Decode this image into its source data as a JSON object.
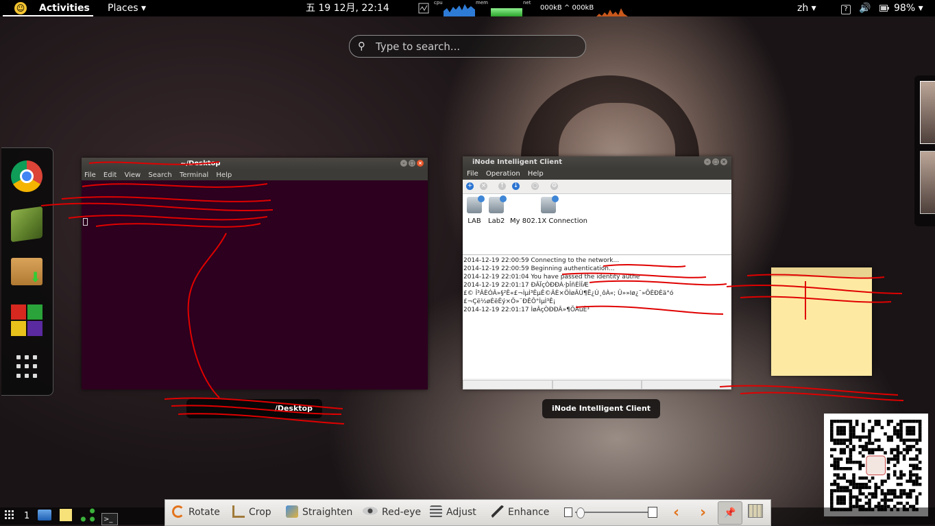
{
  "topbar": {
    "activities": "Activities",
    "places": "Places ▾",
    "clock": "五 19 12月, 22:14",
    "cpu_label": "cpu",
    "mem_label": "mem",
    "net_label": "net",
    "net_speed": "000kB ^ 000kB",
    "lang": "zh ▾",
    "help_icon": "?",
    "battery": "98% ▾"
  },
  "search": {
    "placeholder": "Type to search..."
  },
  "dash": {
    "apps": [
      "chrome-icon",
      "book-icon",
      "package-installer-icon",
      "office-blocks-icon",
      "show-apps-icon"
    ]
  },
  "terminal": {
    "title": "~/Desktop",
    "menu": [
      "File",
      "Edit",
      "View",
      "Search",
      "Terminal",
      "Help"
    ],
    "caption": "/Desktop"
  },
  "inode": {
    "title": "iNode Intelligent Client",
    "menu": [
      "File",
      "Operation",
      "Help"
    ],
    "connections": [
      "LAB",
      "Lab2",
      "My 802.1X Connection"
    ],
    "log": [
      "2014-12-19 22:00:59 Connecting to the network...",
      "2014-12-19 22:00:59 Beginning authentication...",
      "2014-12-19 22:01:04 You have passed the identity authe",
      "2014-12-19 22:01:17 ĐÂÏçÒĐÐÁ·þÎñÈÌÎÆ",
      "£© Î³ÂÈÓÂ»§²Ê«£¬ÌµÌ³ÊµÊ©ÂÈ×ÖÌøÂÙ¶Ë¿Ú¸ôÀ«; Ü»»Iø¿¨»ÕÈÐÈä°ó",
      "£¬Çë½øÈëÊý×Ö»¨ÐÊÔ°ÌµÌ³Ê¡",
      "2014-12-19 22:01:17 ÌøÂçÒÐÐÂ»¶ÕÀúÈ³"
    ],
    "caption": "iNode Intelligent Client"
  },
  "bottom": {
    "workspace": "1",
    "tools": [
      "Rotate",
      "Crop",
      "Straighten",
      "Red-eye",
      "Adjust",
      "Enhance"
    ]
  },
  "colors": {
    "terminal_bg": "#2c001e",
    "note_bg": "#fde9a2",
    "accent": "#e8562a"
  }
}
